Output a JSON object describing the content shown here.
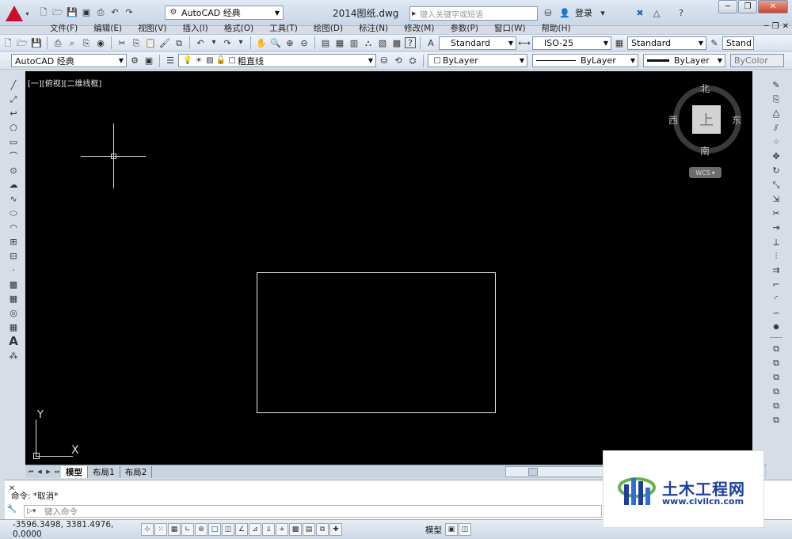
{
  "app": {
    "title": "2014图纸.dwg",
    "workspace": "AutoCAD 经典",
    "search_placeholder": "键入关键字或短语",
    "login": "登录"
  },
  "menus": [
    "文件(F)",
    "编辑(E)",
    "视图(V)",
    "插入(I)",
    "格式(O)",
    "工具(T)",
    "绘图(D)",
    "标注(N)",
    "修改(M)",
    "参数(P)",
    "窗口(W)",
    "帮助(H)"
  ],
  "styles": {
    "text_style": "Standard",
    "dim_style": "ISO-25",
    "table_style": "Standard",
    "multileader_style": "Stand"
  },
  "layers": {
    "workspace_combo": "AutoCAD 经典",
    "current_layer": "粗直线",
    "color": "ByLayer",
    "linetype": "ByLayer",
    "lineweight": "ByLayer",
    "plotstyle": "ByColor"
  },
  "viewport": {
    "label": "[一][俯视][二维线框]",
    "viewcube": {
      "top": "上",
      "north": "北",
      "south": "南",
      "east": "东",
      "west": "西"
    },
    "wcs": "WCS",
    "ucs_x": "X",
    "ucs_y": "Y"
  },
  "tabs": [
    "模型",
    "布局1",
    "布局2"
  ],
  "command": {
    "history": "命令: *取消*",
    "prompt_placeholder": "键入命令"
  },
  "status": {
    "coords": "-3596.3498, 3381.4976, 0.0000",
    "model": "模型"
  },
  "watermark": {
    "title": "土木工程网",
    "url": "www.civilcn.com"
  },
  "colors": {
    "canvas": "#000000",
    "geometry": "#e8e8e8",
    "accent": "#c8102e",
    "watermark": "#1d3f9a"
  }
}
